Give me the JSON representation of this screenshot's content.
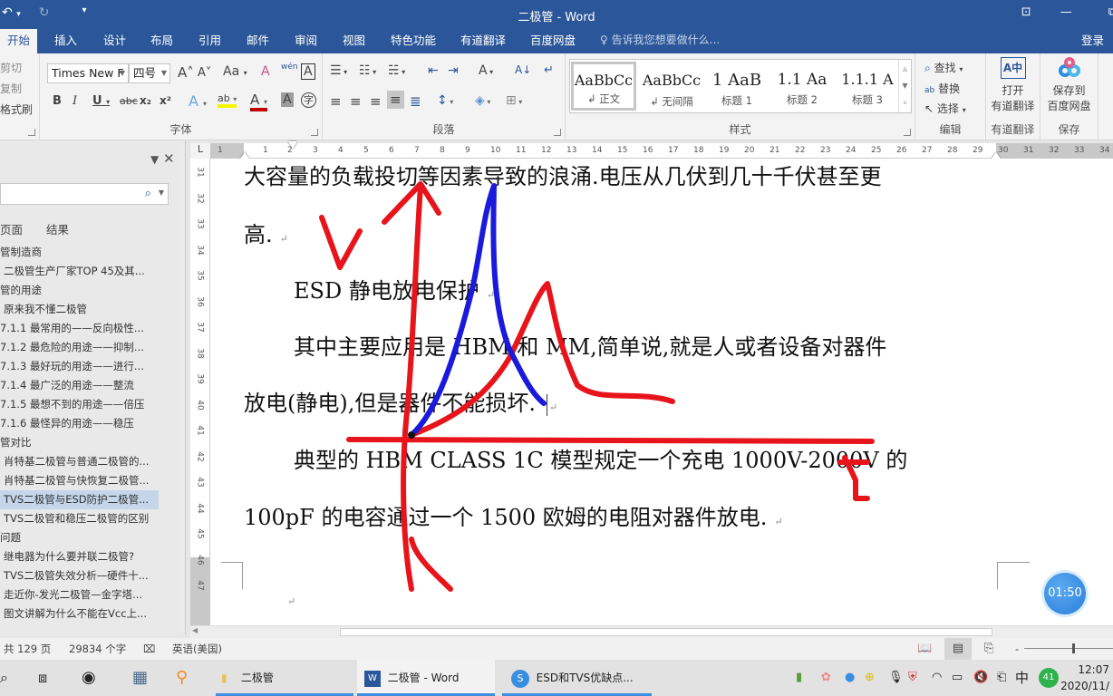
{
  "window": {
    "title": "二极管 - Word",
    "qat": {
      "undo": "↶",
      "undo_dd": "▾",
      "redo": "↻",
      "customize": "▾"
    },
    "controls": {
      "ribbon_display": "⊡",
      "minimize": "—",
      "restore": "⧉"
    }
  },
  "tabs": [
    "开始",
    "插入",
    "设计",
    "布局",
    "引用",
    "邮件",
    "审阅",
    "视图",
    "特色功能",
    "有道翻译",
    "百度网盘"
  ],
  "active_tab": "开始",
  "tell_me": "告诉我您想要做什么...",
  "login": "登录",
  "ribbon": {
    "clipboard": {
      "cut": "剪切",
      "copy": "复制",
      "format_painter": "格式刷"
    },
    "font": {
      "label": "字体",
      "font_name": "Times New F",
      "font_size": "四号",
      "grow": "A˄",
      "shrink": "A˅",
      "change_case": "Aa",
      "clear_format": "A",
      "phonetic": "wén",
      "border_char": "A",
      "bold": "B",
      "italic": "I",
      "underline": "U",
      "strike": "abc",
      "subscript": "x₂",
      "superscript": "x²",
      "text_effect": "A",
      "highlight": "ab",
      "font_color": "A",
      "char_shading": "A",
      "enclose": "字"
    },
    "paragraph": {
      "label": "段落",
      "bullets": "☰",
      "numbering": "☷",
      "multilevel": "☵",
      "dec_indent": "⇤",
      "inc_indent": "⇥",
      "chinese_layout": "A",
      "sort": "A↓",
      "show_marks": "↵",
      "align_left": "≡",
      "center": "≡",
      "align_right": "≡",
      "justify": "≡",
      "distributed": "≣",
      "line_spacing": "↕",
      "shading": "◈",
      "borders": "⊞"
    },
    "styles": {
      "label": "样式",
      "items": [
        {
          "preview": "AaBbCc",
          "name": "↲ 正文"
        },
        {
          "preview": "AaBbCc",
          "name": "↲ 无间隔"
        },
        {
          "preview": "1  AaB",
          "name": "标题 1"
        },
        {
          "preview": "1.1  Aa",
          "name": "标题 2"
        },
        {
          "preview": "1.1.1  A",
          "name": "标题 3"
        }
      ]
    },
    "editing": {
      "label": "编辑",
      "find": "查找",
      "replace": "替换",
      "select": "选择"
    },
    "youdao": {
      "label": "有道翻译",
      "button_line1": "打开",
      "button_line2": "有道翻译"
    },
    "baidu": {
      "label": "保存",
      "button_line1": "保存到",
      "button_line2": "百度网盘"
    }
  },
  "ruler": {
    "corner": "L",
    "h_ticks": [
      "1",
      "1",
      "2",
      "3",
      "4",
      "5",
      "6",
      "7",
      "8",
      "9",
      "10",
      "11",
      "12",
      "13",
      "14",
      "15",
      "16",
      "17",
      "18",
      "19",
      "20",
      "21",
      "22",
      "23",
      "24",
      "25",
      "26",
      "27",
      "28",
      "29",
      "30",
      "31",
      "32",
      "33",
      "34"
    ],
    "v_ticks": [
      "31",
      "32",
      "33",
      "34",
      "35",
      "36",
      "37",
      "38",
      "39",
      "40",
      "41",
      "42",
      "43",
      "44",
      "45",
      "46",
      "47"
    ]
  },
  "nav_pane": {
    "tabs": [
      "页面",
      "结果"
    ],
    "items": [
      {
        "text": "管制造商",
        "level": 1
      },
      {
        "text": "二极管生产厂家TOP 45及其...",
        "level": 2
      },
      {
        "text": "管的用途",
        "level": 1
      },
      {
        "text": "原来我不懂二极管",
        "level": 2
      },
      {
        "text": "7.1.1 最常用的——反向极性...",
        "level": 1
      },
      {
        "text": "7.1.2 最危险的用途——抑制...",
        "level": 1
      },
      {
        "text": "7.1.3 最好玩的用途——进行...",
        "level": 1
      },
      {
        "text": "7.1.4 最广泛的用途——整流",
        "level": 1
      },
      {
        "text": "7.1.5 最想不到的用途——倍压",
        "level": 1
      },
      {
        "text": "7.1.6 最怪异的用途——稳压",
        "level": 1
      },
      {
        "text": "管对比",
        "level": 1
      },
      {
        "text": "肖特基二极管与普通二极管的...",
        "level": 2
      },
      {
        "text": "肖特基二极管与快恢复二极管...",
        "level": 2
      },
      {
        "text": "TVS二极管与ESD防护二极管...",
        "level": 2,
        "selected": true
      },
      {
        "text": "TVS二极管和稳压二极管的区别",
        "level": 2
      },
      {
        "text": "问题",
        "level": 1
      },
      {
        "text": "继电器为什么要并联二极管?",
        "level": 2
      },
      {
        "text": "TVS二极管失效分析—硬件十...",
        "level": 2
      },
      {
        "text": "走近你-发光二极管—金字塔...",
        "level": 2
      },
      {
        "text": "图文讲解为什么不能在Vcc上...",
        "level": 2
      }
    ]
  },
  "document": {
    "lines": [
      "大容量的负载投切等因素导致的浪涌.电压从几伏到几十千伏甚至更",
      "高.",
      "ESD 静电放电保护",
      "其中主要应用是  HBM  和  MM,简单说,就是人或者设备对器件",
      "放电(静电),但是器件不能损坏.",
      "典型的  HBM  CLASS  1C  模型规定一个充电  1000V-2000V  的",
      "100pF 的电容通过一个 1500 欧姆的电阻对器件放电."
    ],
    "para_mark": "↵",
    "annotations": {
      "v_label": "V",
      "t_label": "t",
      "red": "#e8141b",
      "blue": "#1a1adc"
    }
  },
  "timer": "01:50",
  "status": {
    "pages": "共 129 页",
    "words": "29834 个字",
    "proof": "⌧",
    "language": "英语(美国)",
    "views": [
      "read",
      "print",
      "web"
    ]
  },
  "taskbar": {
    "items": [
      {
        "label": "二极管",
        "icon": "folder"
      },
      {
        "label": "二极管 - Word",
        "icon": "word"
      },
      {
        "label": "ESD和TVS优缺点...",
        "icon": "sogou"
      }
    ],
    "tray": {
      "ime": "中",
      "badge": "41",
      "time": "12:07",
      "date": "2020/11/"
    }
  }
}
